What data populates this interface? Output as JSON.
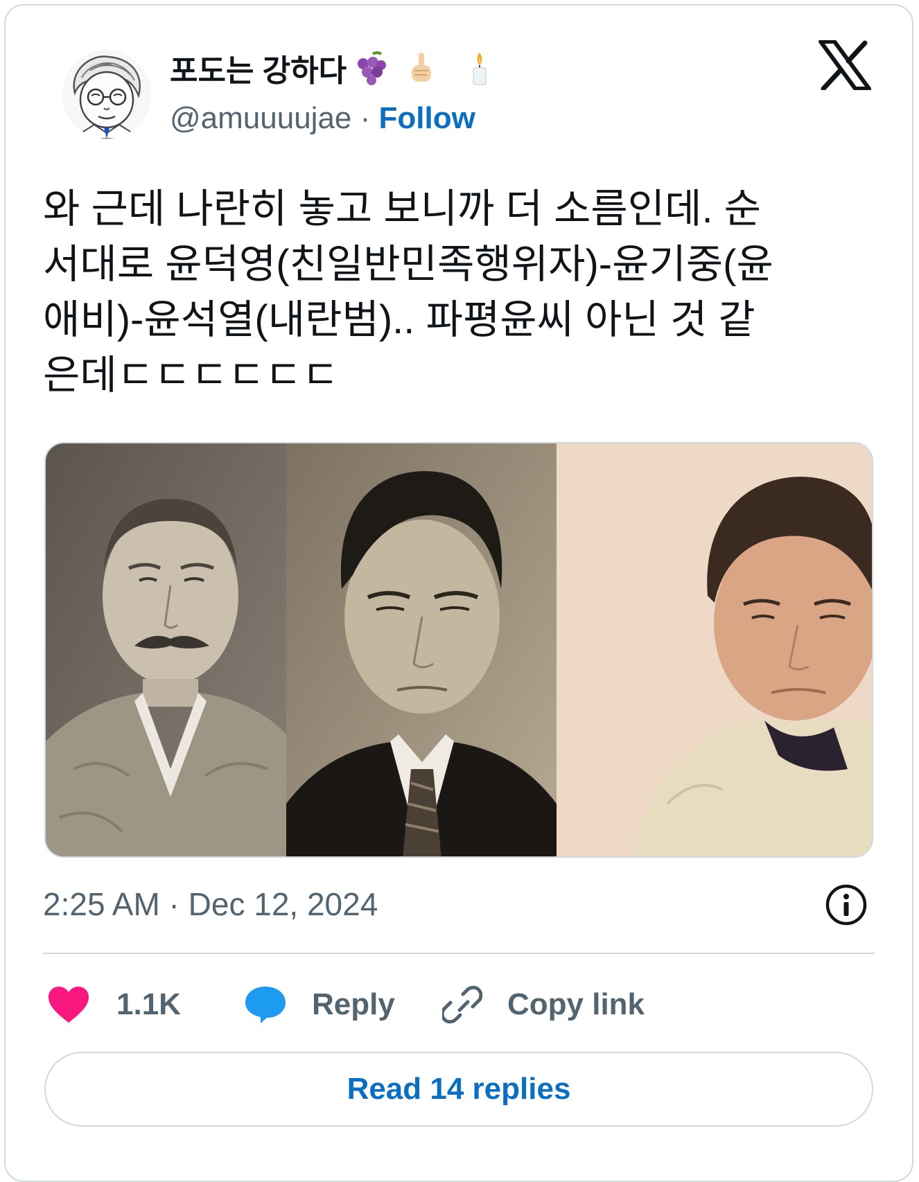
{
  "author": {
    "display_name": "포도는 강하다",
    "handle": "@amuuuujae",
    "separator": " · ",
    "follow_label": "Follow",
    "name_emojis": [
      "grapes-icon",
      "index-pointing-up-icon",
      "candle-icon"
    ]
  },
  "tweet": {
    "lines": [
      "와 근데 나란히 놓고 보니까 더 소름인데. 순",
      "서대로 윤덕영(친일반민족행위자)-윤기중(윤",
      "애비)-윤석열(내란범).. 파평윤씨 아닌 것 같",
      "은데ㄷㄷㄷㄷㄷㄷ"
    ],
    "timestamp": "2:25 AM · Dec 12, 2024"
  },
  "actions": {
    "like_count": "1.1K",
    "reply_label": "Reply",
    "copy_link_label": "Copy link"
  },
  "footer": {
    "read_replies_label": "Read 14 replies"
  },
  "colors": {
    "link_blue": "#0a6fc2",
    "like_pink": "#f91880",
    "reply_blue": "#1d9bf0",
    "muted_text": "#536471",
    "border": "#cfd9de"
  }
}
